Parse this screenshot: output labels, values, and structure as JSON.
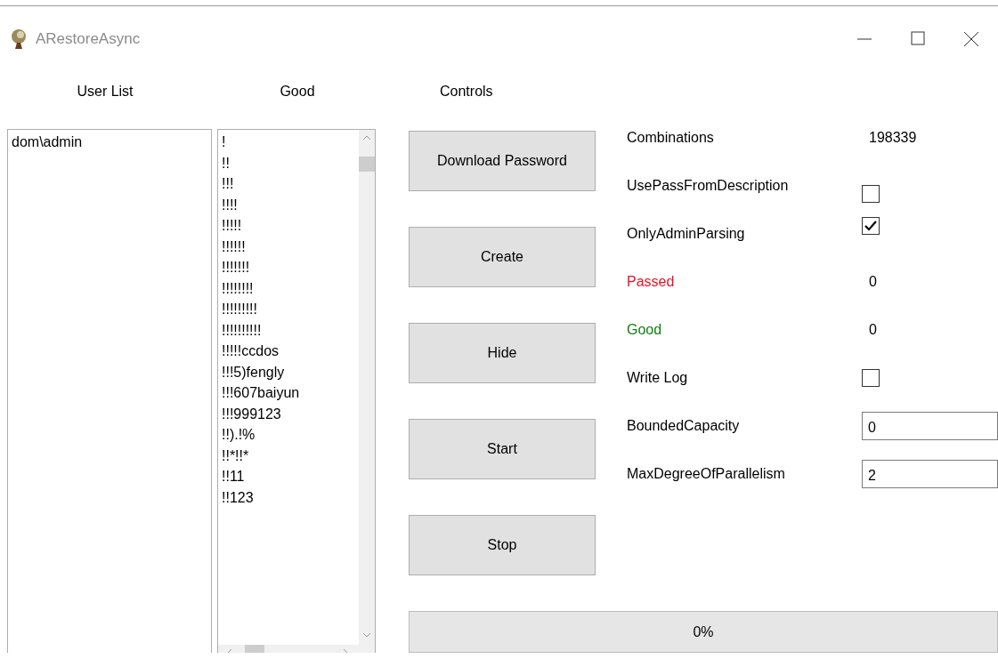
{
  "window": {
    "title": "ARestoreAsync"
  },
  "headers": [
    "User List",
    "Good",
    "Controls"
  ],
  "user_list": {
    "items": [
      "dom\\admin"
    ]
  },
  "good_list": {
    "items": [
      "!",
      "!!",
      "!!!",
      "!!!!",
      "!!!!!",
      "!!!!!!",
      "!!!!!!!",
      "!!!!!!!!",
      "!!!!!!!!!",
      "!!!!!!!!!!",
      "!!!!!ccdos",
      "!!!5)fengly",
      "!!!607baiyun",
      "!!!999123",
      "!!).!%",
      "!!*!!*",
      "!!11",
      "!!123"
    ]
  },
  "buttons": [
    "Download Password",
    "Create",
    "Hide",
    "Start",
    "Stop"
  ],
  "settings": [
    {
      "kind": "value",
      "label": "Combinations",
      "value": "198339"
    },
    {
      "kind": "check",
      "label": "UsePassFromDescription",
      "checked": false
    },
    {
      "kind": "check",
      "label": "OnlyAdminParsing",
      "checked": true
    },
    {
      "kind": "value",
      "label": "Passed",
      "value": "0",
      "color": "#e81123"
    },
    {
      "kind": "value",
      "label": "Good",
      "value": "0",
      "color": "#107c10"
    },
    {
      "kind": "check",
      "label": "Write Log",
      "checked": false
    },
    {
      "kind": "field",
      "label": "BoundedCapacity",
      "value": "0"
    },
    {
      "kind": "field",
      "label": "MaxDegreeOfParallelism",
      "value": "2"
    }
  ],
  "progress": {
    "level": 0,
    "label": "0%"
  }
}
